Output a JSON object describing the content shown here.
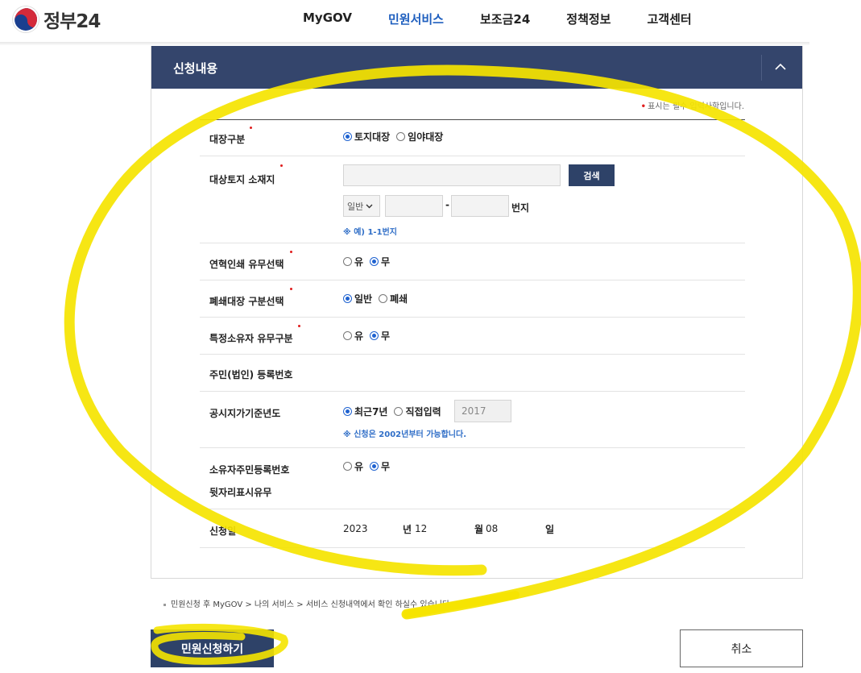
{
  "header": {
    "logo_text": "정부24",
    "nav": [
      {
        "label": "MyGOV",
        "active": false
      },
      {
        "label": "민원서비스",
        "active": true
      },
      {
        "label": "보조금24",
        "active": false
      },
      {
        "label": "정책정보",
        "active": false
      },
      {
        "label": "고객센터",
        "active": false
      }
    ]
  },
  "panel": {
    "title": "신청내용",
    "required_note": "표시는 필수 입력사항입니다."
  },
  "form": {
    "ledger_type": {
      "label": "대장구분",
      "options": [
        "토지대장",
        "임야대장"
      ],
      "selected": "토지대장"
    },
    "land_location": {
      "label": "대상토지 소재지",
      "search_button": "검색",
      "lot_select": "일반",
      "dash": "-",
      "unit": "번지",
      "hint": "※ 예) 1-1번지"
    },
    "history_print": {
      "label": "연혁인쇄 유무선택",
      "options": [
        "유",
        "무"
      ],
      "selected": "무"
    },
    "closed_ledger": {
      "label": "폐쇄대장 구분선택",
      "options": [
        "일반",
        "폐쇄"
      ],
      "selected": "일반"
    },
    "special_owner": {
      "label": "특정소유자 유무구분",
      "options": [
        "유",
        "무"
      ],
      "selected": "무"
    },
    "resident_number": {
      "label": "주민(법인) 등록번호"
    },
    "price_year": {
      "label": "공시지가기준년도",
      "options": [
        "최근7년",
        "직접입력"
      ],
      "selected": "최근7년",
      "year_value": "2017",
      "hint": "※ 신청은 2002년부터 가능합니다."
    },
    "owner_rrn_display": {
      "label_line1": "소유자주민등록번호",
      "label_line2": "뒷자리표시유무",
      "options": [
        "유",
        "무"
      ],
      "selected": "무"
    },
    "apply_date": {
      "label": "신청일",
      "year": "2023",
      "year_unit": "년",
      "month": "12",
      "month_unit": "월",
      "day": "08",
      "day_unit": "일"
    }
  },
  "footnote": "민원신청 후 MyGOV > 나의 서비스 > 서비스 신청내역에서 확인 하실수 있습니다.",
  "buttons": {
    "apply": "민원신청하기",
    "cancel": "취소"
  },
  "colors": {
    "header_bar": "#34456c",
    "accent_blue": "#1f5fbf",
    "required_red": "#e01e1e",
    "annotation_yellow": "#f5e400"
  }
}
